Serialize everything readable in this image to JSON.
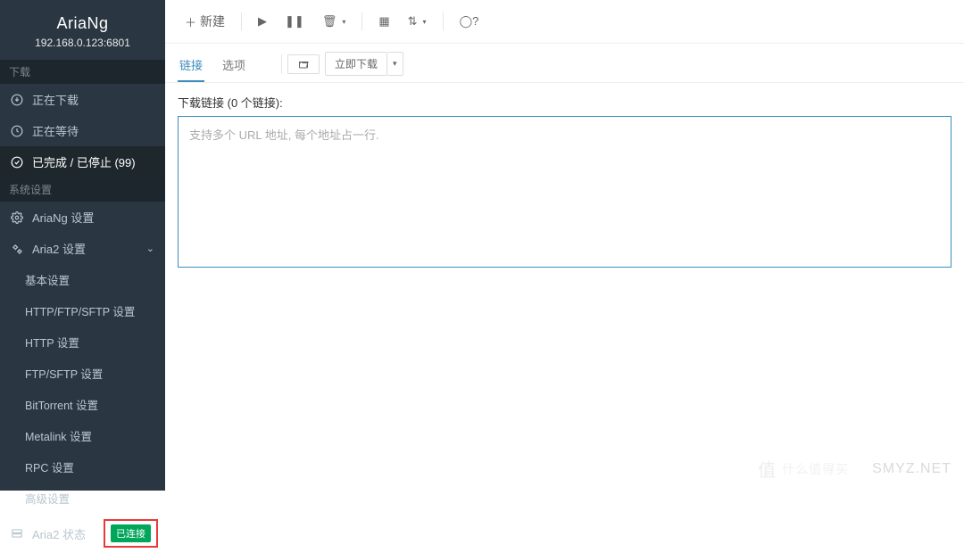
{
  "brand": {
    "title": "AriaNg",
    "address": "192.168.0.123:6801"
  },
  "sidebar": {
    "section_downloads": "下载",
    "section_system": "系统设置",
    "downloading": "正在下载",
    "waiting": "正在等待",
    "finished": "已完成 / 已停止 (99)",
    "ariang_settings": "AriaNg 设置",
    "aria2_settings": "Aria2 设置",
    "sub": {
      "basic": "基本设置",
      "http_ftp_sftp": "HTTP/FTP/SFTP 设置",
      "http": "HTTP 设置",
      "ftp_sftp": "FTP/SFTP 设置",
      "bt": "BitTorrent 设置",
      "metalink": "Metalink 设置",
      "rpc": "RPC 设置",
      "advanced": "高级设置"
    },
    "aria2_status": "Aria2 状态",
    "status_badge": "已连接"
  },
  "toolbar": {
    "new_label": "新建"
  },
  "tabs": {
    "links": "链接",
    "options": "选项",
    "download_now": "立即下载"
  },
  "content": {
    "links_label": "下载链接 (0 个链接):",
    "placeholder": "支持多个 URL 地址, 每个地址占一行."
  },
  "watermark": {
    "text1": "值",
    "text2": "SMYZ.NET"
  }
}
